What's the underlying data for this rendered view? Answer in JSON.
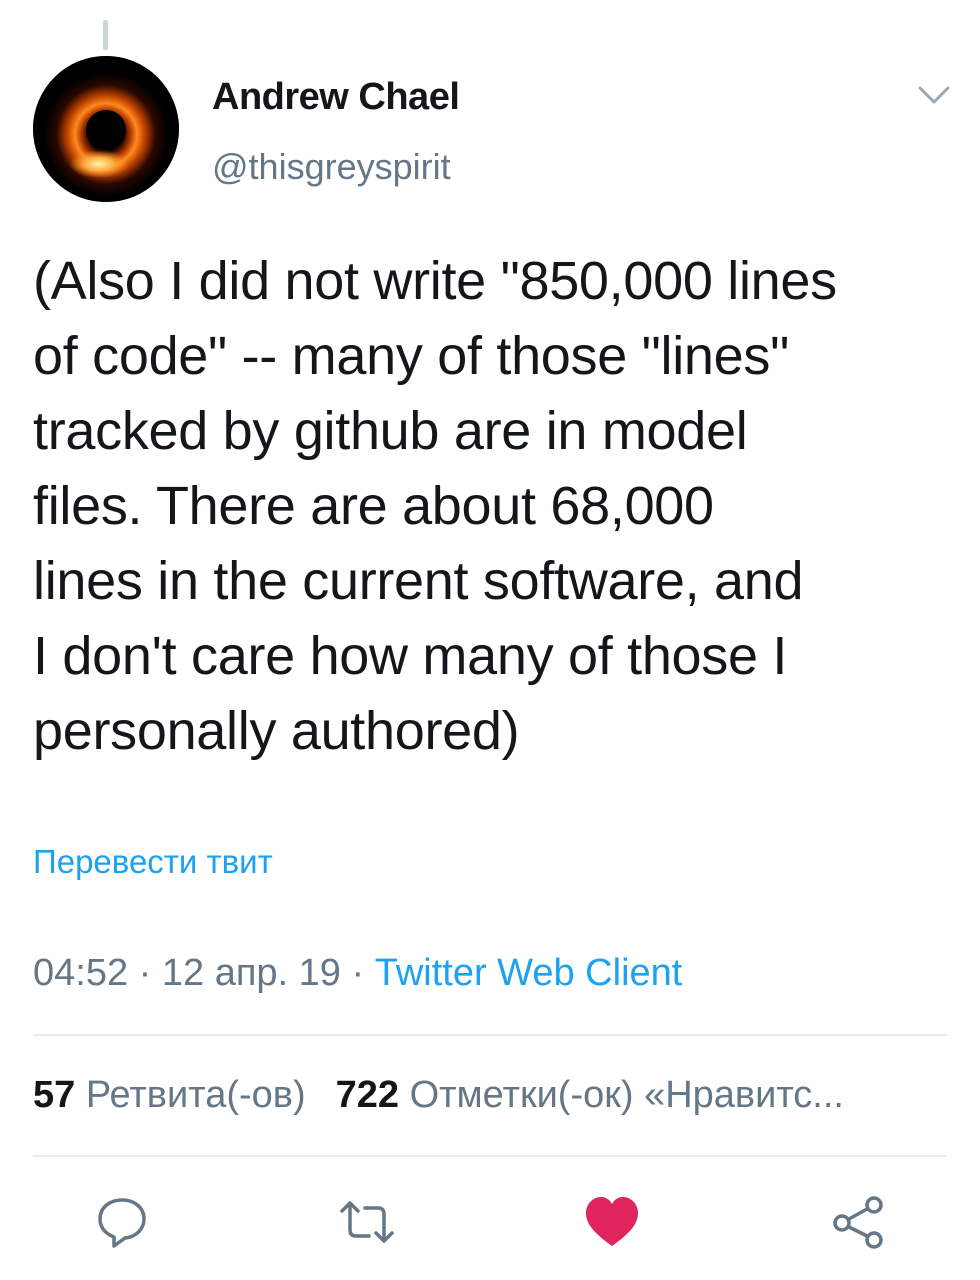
{
  "author": {
    "name": "Andrew Chael",
    "handle": "@thisgreyspirit",
    "avatar_icon": "black-hole-avatar"
  },
  "tweet": {
    "lines": [
      "(Also I did not write \"850,000 lines",
      "of code\" -- many of those \"lines\"",
      "tracked by github are in model",
      "files. There are about 68,000",
      "lines in the current software, and",
      "I don't care how many of those I",
      "personally authored)"
    ],
    "translate_label": "Перевести твит"
  },
  "meta": {
    "time": "04:52",
    "date": "12 апр. 19",
    "separator": "·",
    "source": "Twitter Web Client"
  },
  "stats": {
    "retweets_count": "57",
    "retweets_label": "Ретвита(-ов)",
    "likes_count": "722",
    "likes_label": "Отметки(-ок) «Нравитс..."
  },
  "actions": {
    "reply_icon": "reply-icon",
    "retweet_icon": "retweet-icon",
    "like_icon": "heart-icon",
    "share_icon": "share-icon"
  },
  "colors": {
    "text": "#14171a",
    "secondary": "#657786",
    "link": "#1da1f2",
    "like": "#e0245e",
    "divider": "#e6ecf0"
  }
}
